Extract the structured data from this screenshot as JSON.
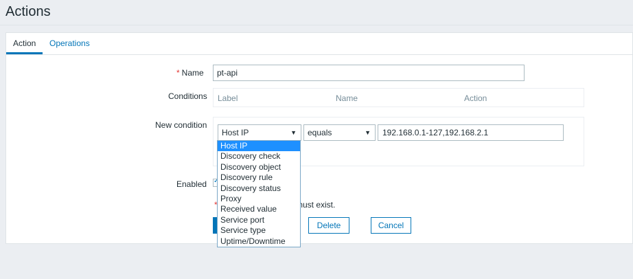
{
  "page": {
    "title": "Actions"
  },
  "tabs": [
    {
      "label": "Action",
      "active": true
    },
    {
      "label": "Operations",
      "active": false
    }
  ],
  "form": {
    "name": {
      "label": "Name",
      "required_mark": "*",
      "value": "pt-api"
    },
    "conditions": {
      "label": "Conditions",
      "columns": [
        "Label",
        "Name",
        "Action"
      ]
    },
    "new_condition": {
      "label": "New condition",
      "type_select": {
        "value": "Host IP"
      },
      "operator_select": {
        "value": "equals"
      },
      "value_input": {
        "value": "192.168.0.1-127,192.168.2.1"
      }
    },
    "enabled": {
      "label": "Enabled",
      "checked": true
    },
    "must_exist": {
      "mark": "*",
      "text": "must exist."
    }
  },
  "buttons": {
    "delete": "Delete",
    "cancel": "Cancel"
  },
  "dropdown": {
    "options": [
      "Host IP",
      "Discovery check",
      "Discovery object",
      "Discovery rule",
      "Discovery status",
      "Proxy",
      "Received value",
      "Service port",
      "Service type",
      "Uptime/Downtime"
    ],
    "selected": "Host IP"
  },
  "icons": {
    "select_arrow": "▼",
    "checkbox_tick": "✓"
  },
  "colors": {
    "accent": "#0275b8",
    "required": "#e33734",
    "selection": "#1e90ff"
  }
}
